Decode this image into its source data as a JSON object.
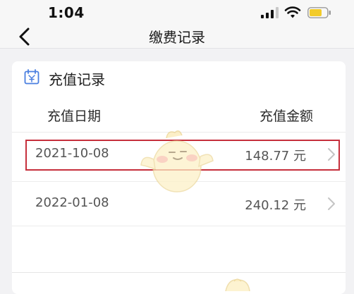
{
  "status_bar": {
    "time": "1:04",
    "icons": [
      "cellular-signal-icon",
      "wifi-icon",
      "battery-icon"
    ],
    "battery_color": "#f2cb2a"
  },
  "nav": {
    "title": "缴费记录",
    "back_icon": "chevron-left-icon"
  },
  "card": {
    "icon": "calendar-icon",
    "icon_color": "#4a7fe0",
    "title": "充值记录",
    "columns": {
      "date": "充值日期",
      "amount": "充值金额"
    },
    "rows": [
      {
        "date": "2021-10-08",
        "amount": "148.77 元",
        "highlighted": true
      },
      {
        "date": "2022-01-08",
        "amount": "240.12 元",
        "highlighted": false
      }
    ]
  },
  "annotation": {
    "highlight_color": "#c62f3c"
  },
  "overlay": {
    "icon": "mascot-sticker-icon"
  }
}
